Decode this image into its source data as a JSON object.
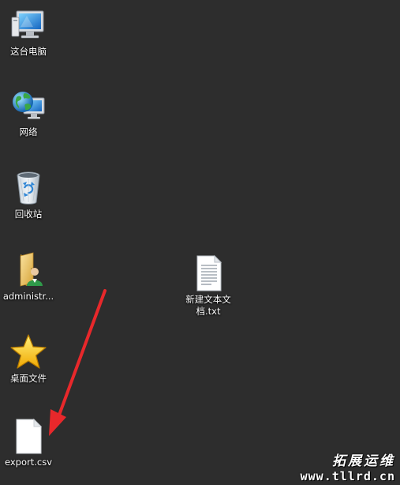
{
  "desktop": {
    "icons": [
      {
        "label": "这台电脑",
        "icon": "computer-icon"
      },
      {
        "label": "网络",
        "icon": "network-icon"
      },
      {
        "label": "回收站",
        "icon": "recycle-bin-icon"
      },
      {
        "label": "administr...",
        "icon": "user-folder-icon"
      },
      {
        "label": "桌面文件",
        "icon": "star-icon"
      },
      {
        "label": "export.csv",
        "icon": "blank-file-icon"
      },
      {
        "label_line1": "新建文本文",
        "label_line2": "档.txt",
        "icon": "text-file-icon"
      }
    ]
  },
  "annotation": {
    "arrow_color": "#e8282b"
  },
  "watermark": {
    "line1": "拓展运维",
    "line2": "www.tllrd.cn"
  },
  "colors": {
    "background": "#2d2d2d"
  }
}
